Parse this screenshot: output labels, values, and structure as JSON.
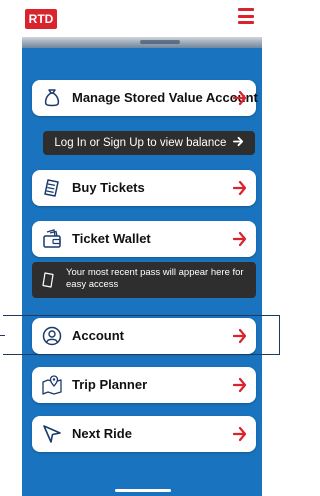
{
  "header": {
    "logo_text": "RTD",
    "brand_color": "#d9232d",
    "menu_icon": "hamburger-icon"
  },
  "theme": {
    "background": "#1a73bf",
    "card_background": "#ffffff",
    "dark_background": "#2e2e2e",
    "arrow_color": "#d9232d"
  },
  "menu": {
    "manage_stored_value": {
      "label": "Manage Stored Value Account",
      "icon": "moneybag-icon"
    },
    "login_prompt": {
      "label": "Log In or Sign Up to view balance"
    },
    "buy_tickets": {
      "label": "Buy Tickets",
      "icon": "ticket-icon"
    },
    "ticket_wallet": {
      "label": "Ticket Wallet",
      "icon": "wallet-ticket-icon"
    },
    "recent_pass_notice": {
      "text": "Your most recent pass will appear here for easy access",
      "icon": "ticket-outline-icon"
    },
    "account": {
      "label": "Account",
      "icon": "user-circle-icon"
    },
    "trip_planner": {
      "label": "Trip Planner",
      "icon": "map-pin-icon"
    },
    "next_ride": {
      "label": "Next Ride",
      "icon": "navigation-arrow-icon"
    }
  }
}
